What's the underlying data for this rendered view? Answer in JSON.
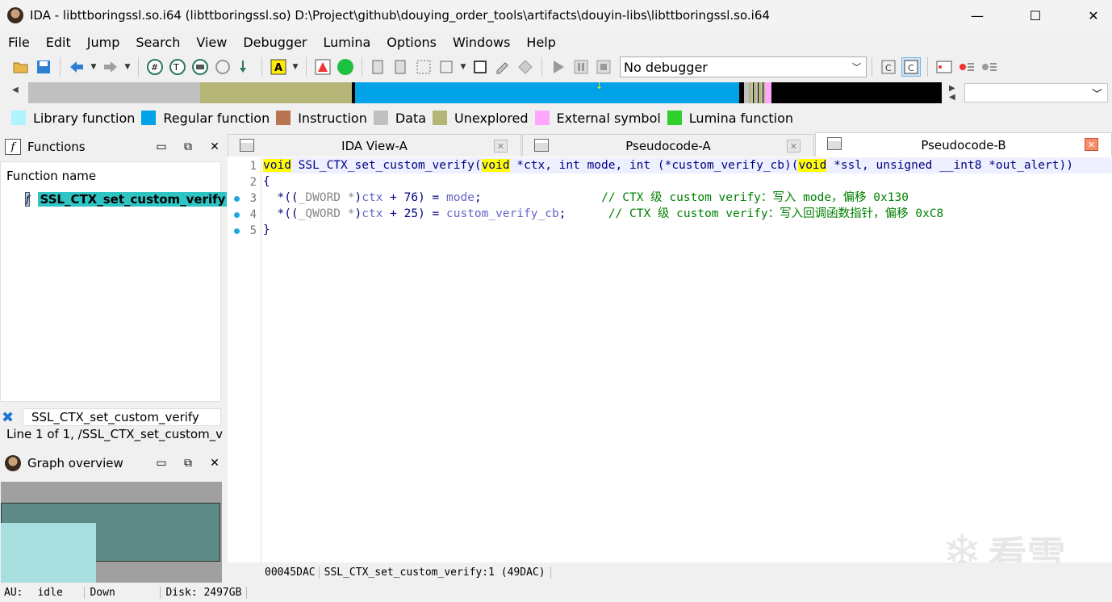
{
  "window": {
    "title": "IDA - libttboringssl.so.i64 (libttboringssl.so) D:\\Project\\github\\douying_order_tools\\artifacts\\douyin-libs\\libttboringssl.so.i64",
    "minimize": "—",
    "maximize": "☐",
    "close": "✕"
  },
  "menu": [
    "File",
    "Edit",
    "Jump",
    "Search",
    "View",
    "Debugger",
    "Lumina",
    "Options",
    "Windows",
    "Help"
  ],
  "toolbar": {
    "debugger_select": "No debugger"
  },
  "legend": [
    {
      "label": "Library function",
      "color": "#aef4ff"
    },
    {
      "label": "Regular function",
      "color": "#00a2e8"
    },
    {
      "label": "Instruction",
      "color": "#b87350"
    },
    {
      "label": "Data",
      "color": "#c0c0c0"
    },
    {
      "label": "Unexplored",
      "color": "#b5b577"
    },
    {
      "label": "External symbol",
      "color": "#ffa6ff"
    },
    {
      "label": "Lumina function",
      "color": "#2ed02e"
    }
  ],
  "functions_panel": {
    "title": "Functions",
    "column_header": "Function name",
    "items": [
      {
        "name": "SSL_CTX_set_custom_verify",
        "selected": true
      }
    ],
    "filter_value": "SSL_CTX_set_custom_verify",
    "status": "Line 1 of 1, /SSL_CTX_set_custom_v"
  },
  "graph_overview": {
    "title": "Graph overview"
  },
  "tabs": [
    {
      "label": "IDA View-A",
      "active": false
    },
    {
      "label": "Pseudocode-A",
      "active": false
    },
    {
      "label": "Pseudocode-B",
      "active": true
    }
  ],
  "code": {
    "line_numbers": [
      "1",
      "2",
      "3",
      "4",
      "5"
    ],
    "l1": {
      "kw1": "void",
      "t1": " SSL_CTX_set_custom_verify(",
      "kw2": "void",
      "t2": " *ctx, int mode, int (*custom_verify_cb)(",
      "kw3": "void",
      "t3": " *ssl, unsigned __int8 *out_alert))"
    },
    "l2": "{",
    "l3": {
      "a": "  *((",
      "cast": "_DWORD *",
      "b": ")",
      "var1": "ctx",
      "c": " + 76) = ",
      "var2": "mode",
      "d": ";                 ",
      "comment": "// CTX 级 custom verify：写入 mode，偏移 0x130"
    },
    "l4": {
      "a": "  *((",
      "cast": "_QWORD *",
      "b": ")",
      "var1": "ctx",
      "c": " + 25) = ",
      "var2": "custom_verify_cb",
      "d": ";      ",
      "comment": "// CTX 级 custom verify：写入回调函数指针，偏移 0xC8"
    },
    "l5": "}"
  },
  "code_status": {
    "address": "00045DAC",
    "location": "SSL_CTX_set_custom_verify:1 (49DAC)"
  },
  "statusbar": {
    "au": "AU:",
    "au_value": "idle",
    "direction": "Down",
    "disk": "Disk: 2497GB"
  },
  "watermark": "看雪"
}
